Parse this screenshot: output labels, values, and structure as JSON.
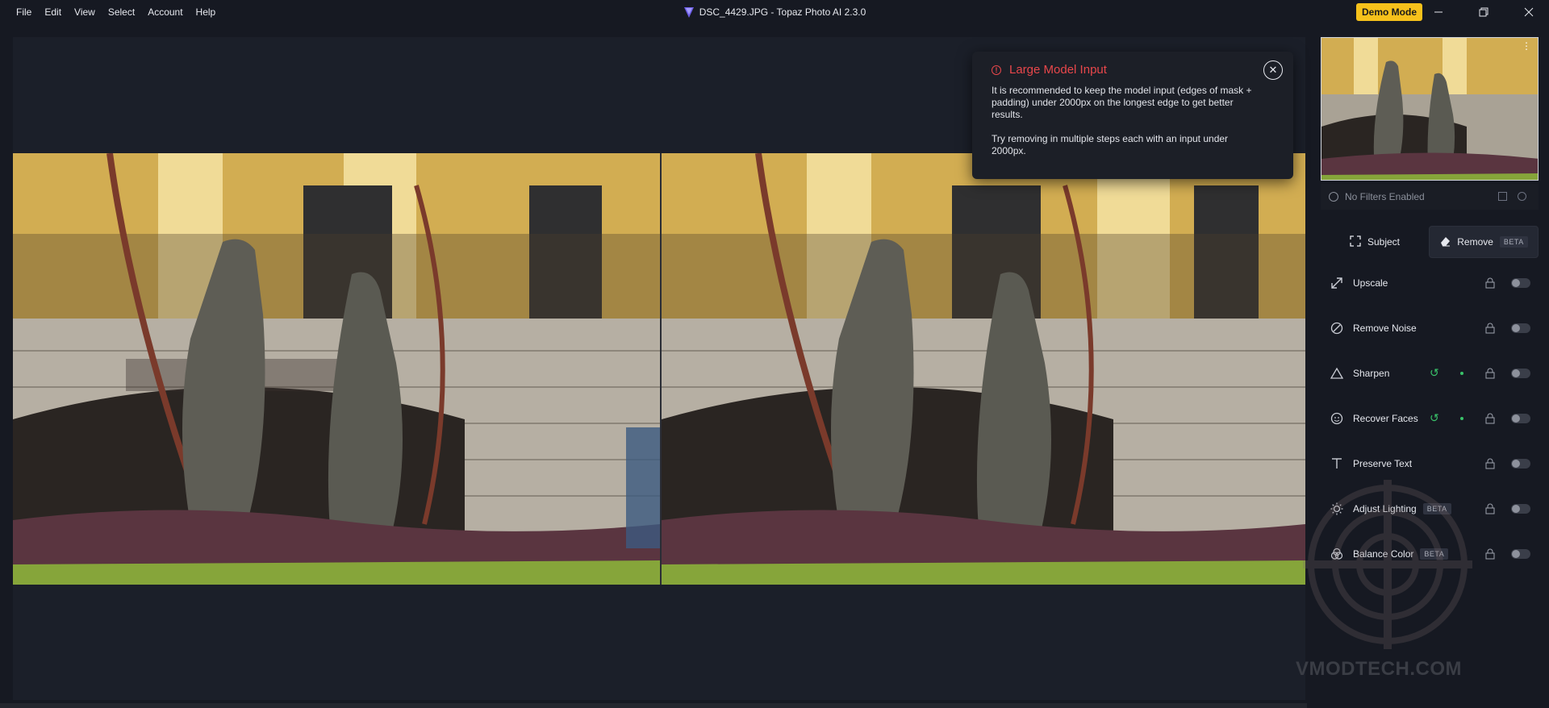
{
  "menu": {
    "file": "File",
    "edit": "Edit",
    "view": "View",
    "select": "Select",
    "account": "Account",
    "help": "Help"
  },
  "window": {
    "title": "DSC_4429.JPG - Topaz Photo AI 2.3.0",
    "demo_mode": "Demo Mode"
  },
  "dialog": {
    "title": "Large Model Input",
    "paragraph1": "It is recommended to keep the model input (edges of mask + padding) under 2000px on the longest edge to get better results.",
    "paragraph2": "Try removing in multiple steps each with an input under 2000px."
  },
  "panel": {
    "filters_status": "No Filters Enabled",
    "tabs": {
      "subject": "Subject",
      "remove": "Remove",
      "remove_badge": "BETA"
    },
    "features": [
      {
        "label": "Upscale",
        "icon": "upscale-icon"
      },
      {
        "label": "Remove Noise",
        "icon": "remove-noise-icon"
      },
      {
        "label": "Sharpen",
        "icon": "sharpen-icon"
      },
      {
        "label": "Recover Faces",
        "icon": "recover-faces-icon"
      },
      {
        "label": "Preserve Text",
        "icon": "preserve-text-icon"
      },
      {
        "label": "Adjust Lighting",
        "icon": "adjust-lighting-icon",
        "badge": "BETA"
      },
      {
        "label": "Balance Color",
        "icon": "balance-color-icon",
        "badge": "BETA"
      }
    ]
  },
  "watermark": "VMODTECH.COM",
  "colors": {
    "accent_red": "#e8474b",
    "demo_yellow": "#f6c11b",
    "reset_green": "#39c26a"
  }
}
